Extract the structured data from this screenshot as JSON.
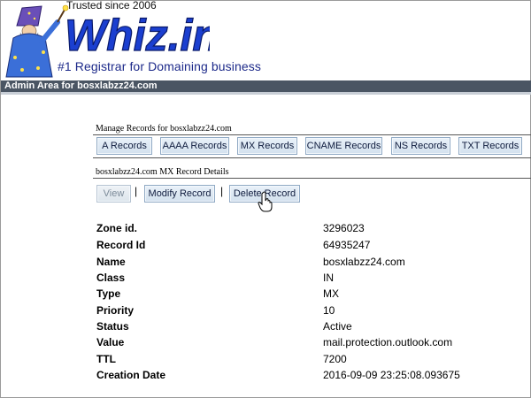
{
  "header": {
    "trusted": "Trusted since 2006",
    "brand": "Whiz.in",
    "tagline": "#1 Registrar for Domaining business"
  },
  "admin_bar": {
    "text": "Admin Area for bosxlabzz24.com"
  },
  "manage": {
    "title": "Manage Records for bosxlabzz24.com",
    "tabs": [
      {
        "label": "A Records"
      },
      {
        "label": "AAAA Records"
      },
      {
        "label": "MX Records"
      },
      {
        "label": "CNAME Records"
      },
      {
        "label": "NS Records"
      },
      {
        "label": "TXT Records"
      }
    ]
  },
  "details": {
    "title": "bosxlabzz24.com MX Record Details",
    "actions": {
      "view": "View",
      "separator": "|",
      "modify": "Modify Record",
      "delete": "Delete Record"
    },
    "rows": [
      {
        "label": "Zone id.",
        "value": "3296023"
      },
      {
        "label": "Record Id",
        "value": "64935247"
      },
      {
        "label": "Name",
        "value": "bosxlabzz24.com"
      },
      {
        "label": "Class",
        "value": "IN"
      },
      {
        "label": "Type",
        "value": "MX"
      },
      {
        "label": "Priority",
        "value": "10"
      },
      {
        "label": "Status",
        "value": "Active"
      },
      {
        "label": "Value",
        "value": "mail.protection.outlook.com"
      },
      {
        "label": "TTL",
        "value": "7200"
      },
      {
        "label": "Creation Date",
        "value": "2016-09-09 23:25:08.093675"
      }
    ]
  },
  "colors": {
    "brand_blue": "#1b3fd0",
    "admin_bar": "#4a5563",
    "button_bg": "#dbe7f2",
    "button_border": "#8fa9c4"
  },
  "icons": {
    "wizard": "wizard-mascot-icon",
    "cursor": "hand-pointer-icon"
  }
}
